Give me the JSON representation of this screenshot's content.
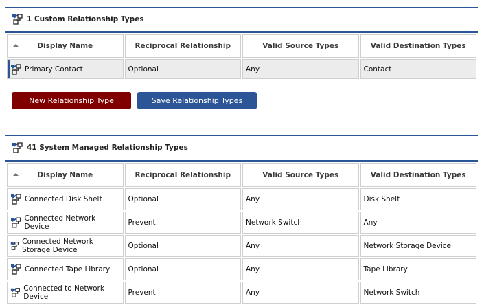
{
  "custom": {
    "title": "1 Custom Relationship Types",
    "columns": [
      "Display Name",
      "Reciprocal Relationship",
      "Valid Source Types",
      "Valid Destination Types"
    ],
    "rows": [
      [
        "Primary Contact",
        "Optional",
        "Any",
        "Contact"
      ]
    ]
  },
  "buttons": {
    "new": "New Relationship Type",
    "save": "Save Relationship Types"
  },
  "system": {
    "title": "41 System Managed Relationship Types",
    "columns": [
      "Display Name",
      "Reciprocal Relationship",
      "Valid Source Types",
      "Valid Destination Types"
    ],
    "rows": [
      [
        "Connected Disk Shelf",
        "Optional",
        "Any",
        "Disk Shelf"
      ],
      [
        "Connected Network Device",
        "Prevent",
        "Network Switch",
        "Any"
      ],
      [
        "Connected Network Storage Device",
        "Optional",
        "Any",
        "Network Storage Device"
      ],
      [
        "Connected Tape Library",
        "Optional",
        "Any",
        "Tape Library"
      ],
      [
        "Connected to Network Device",
        "Prevent",
        "Any",
        "Network Switch"
      ]
    ]
  },
  "colors": {
    "accent": "#2a5597",
    "new_button": "#800000",
    "save_button": "#2b5597"
  }
}
